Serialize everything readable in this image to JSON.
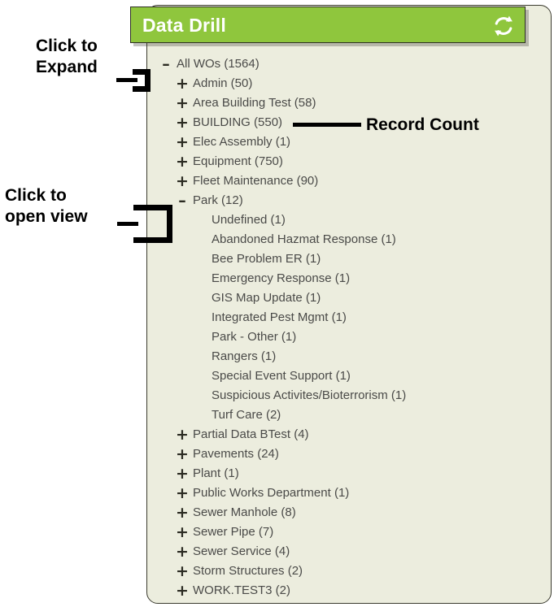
{
  "panel": {
    "header": {
      "title": "Data Drill",
      "refresh_icon": "refresh-icon",
      "bg_color": "#8fc63d",
      "title_color": "#ffffff"
    },
    "bg_color": "#ecedde",
    "border_color": "#3b3b2f"
  },
  "tree": {
    "expand_icon": "+",
    "collapse_icon": "–",
    "items": [
      {
        "label": "All WOs (1564)",
        "name": "All WOs",
        "count": 1564,
        "level": 0,
        "state": "expanded",
        "icon": "minus-icon"
      },
      {
        "label": "Admin (50)",
        "name": "Admin",
        "count": 50,
        "level": 1,
        "state": "collapsed",
        "icon": "plus-icon"
      },
      {
        "label": "Area Building Test (58)",
        "name": "Area Building Test",
        "count": 58,
        "level": 1,
        "state": "collapsed",
        "icon": "plus-icon"
      },
      {
        "label": "BUILDING (550)",
        "name": "BUILDING",
        "count": 550,
        "level": 1,
        "state": "collapsed",
        "icon": "plus-icon"
      },
      {
        "label": "Elec Assembly (1)",
        "name": "Elec Assembly",
        "count": 1,
        "level": 1,
        "state": "collapsed",
        "icon": "plus-icon"
      },
      {
        "label": "Equipment (750)",
        "name": "Equipment",
        "count": 750,
        "level": 1,
        "state": "collapsed",
        "icon": "plus-icon"
      },
      {
        "label": "Fleet Maintenance (90)",
        "name": "Fleet Maintenance",
        "count": 90,
        "level": 1,
        "state": "collapsed",
        "icon": "plus-icon"
      },
      {
        "label": "Park (12)",
        "name": "Park",
        "count": 12,
        "level": 1,
        "state": "expanded",
        "icon": "minus-icon"
      },
      {
        "label": "Undefined (1)",
        "name": "Undefined",
        "count": 1,
        "level": 2,
        "state": "leaf",
        "icon": "none"
      },
      {
        "label": "Abandoned Hazmat Response (1)",
        "name": "Abandoned Hazmat Response",
        "count": 1,
        "level": 2,
        "state": "leaf",
        "icon": "none"
      },
      {
        "label": "Bee Problem ER (1)",
        "name": "Bee Problem ER",
        "count": 1,
        "level": 2,
        "state": "leaf",
        "icon": "none"
      },
      {
        "label": "Emergency Response (1)",
        "name": "Emergency Response",
        "count": 1,
        "level": 2,
        "state": "leaf",
        "icon": "none"
      },
      {
        "label": "GIS Map Update (1)",
        "name": "GIS Map Update",
        "count": 1,
        "level": 2,
        "state": "leaf",
        "icon": "none"
      },
      {
        "label": "Integrated Pest Mgmt (1)",
        "name": "Integrated Pest Mgmt",
        "count": 1,
        "level": 2,
        "state": "leaf",
        "icon": "none"
      },
      {
        "label": "Park - Other (1)",
        "name": "Park - Other",
        "count": 1,
        "level": 2,
        "state": "leaf",
        "icon": "none"
      },
      {
        "label": "Rangers (1)",
        "name": "Rangers",
        "count": 1,
        "level": 2,
        "state": "leaf",
        "icon": "none"
      },
      {
        "label": "Special Event Support (1)",
        "name": "Special Event Support",
        "count": 1,
        "level": 2,
        "state": "leaf",
        "icon": "none"
      },
      {
        "label": "Suspicious Activites/Bioterrorism (1)",
        "name": "Suspicious Activites/Bioterrorism",
        "count": 1,
        "level": 2,
        "state": "leaf",
        "icon": "none"
      },
      {
        "label": "Turf Care (2)",
        "name": "Turf Care",
        "count": 2,
        "level": 2,
        "state": "leaf",
        "icon": "none"
      },
      {
        "label": "Partial Data BTest (4)",
        "name": "Partial Data BTest",
        "count": 4,
        "level": 1,
        "state": "collapsed",
        "icon": "plus-icon"
      },
      {
        "label": "Pavements (24)",
        "name": "Pavements",
        "count": 24,
        "level": 1,
        "state": "collapsed",
        "icon": "plus-icon"
      },
      {
        "label": "Plant (1)",
        "name": "Plant",
        "count": 1,
        "level": 1,
        "state": "collapsed",
        "icon": "plus-icon"
      },
      {
        "label": "Public Works Department (1)",
        "name": "Public Works Department",
        "count": 1,
        "level": 1,
        "state": "collapsed",
        "icon": "plus-icon"
      },
      {
        "label": "Sewer Manhole (8)",
        "name": "Sewer Manhole",
        "count": 8,
        "level": 1,
        "state": "collapsed",
        "icon": "plus-icon"
      },
      {
        "label": "Sewer Pipe (7)",
        "name": "Sewer Pipe",
        "count": 7,
        "level": 1,
        "state": "collapsed",
        "icon": "plus-icon"
      },
      {
        "label": "Sewer Service (4)",
        "name": "Sewer Service",
        "count": 4,
        "level": 1,
        "state": "collapsed",
        "icon": "plus-icon"
      },
      {
        "label": "Storm Structures (2)",
        "name": "Storm Structures",
        "count": 2,
        "level": 1,
        "state": "collapsed",
        "icon": "plus-icon"
      },
      {
        "label": "WORK.TEST3 (2)",
        "name": "WORK.TEST3",
        "count": 2,
        "level": 1,
        "state": "collapsed",
        "icon": "plus-icon"
      }
    ]
  },
  "annotations": {
    "expand": {
      "line1": "Click to",
      "line2": "Expand"
    },
    "open_view": {
      "line1": "Click to",
      "line2": "open view"
    },
    "record_count": {
      "text": "Record Count"
    }
  }
}
